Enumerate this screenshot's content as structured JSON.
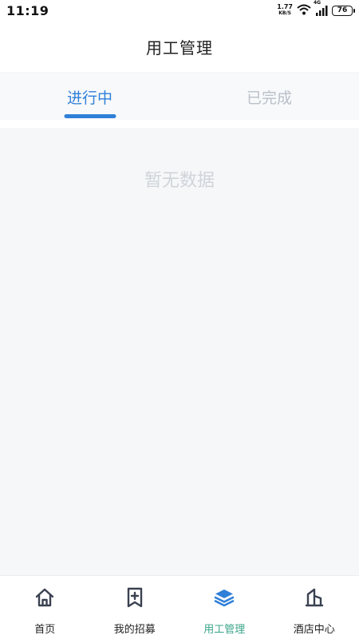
{
  "status_bar": {
    "time": "11:19",
    "net_speed_value": "1.77",
    "net_speed_unit": "KB/S",
    "network_type": "4G",
    "battery": "76"
  },
  "header": {
    "title": "用工管理"
  },
  "tabs": [
    {
      "label": "进行中",
      "active": true
    },
    {
      "label": "已完成",
      "active": false
    }
  ],
  "content": {
    "empty_text": "暂无数据"
  },
  "bottom_nav": {
    "items": [
      {
        "label": "首页",
        "icon": "home-icon",
        "active": false
      },
      {
        "label": "我的招募",
        "icon": "recruit-icon",
        "active": false
      },
      {
        "label": "用工管理",
        "icon": "layers-icon",
        "active": true
      },
      {
        "label": "酒店中心",
        "icon": "building-icon",
        "active": false
      }
    ]
  },
  "colors": {
    "accent": "#2f80d8",
    "active_nav": "#3aa58a",
    "inactive_tab": "#b9c0c8"
  }
}
